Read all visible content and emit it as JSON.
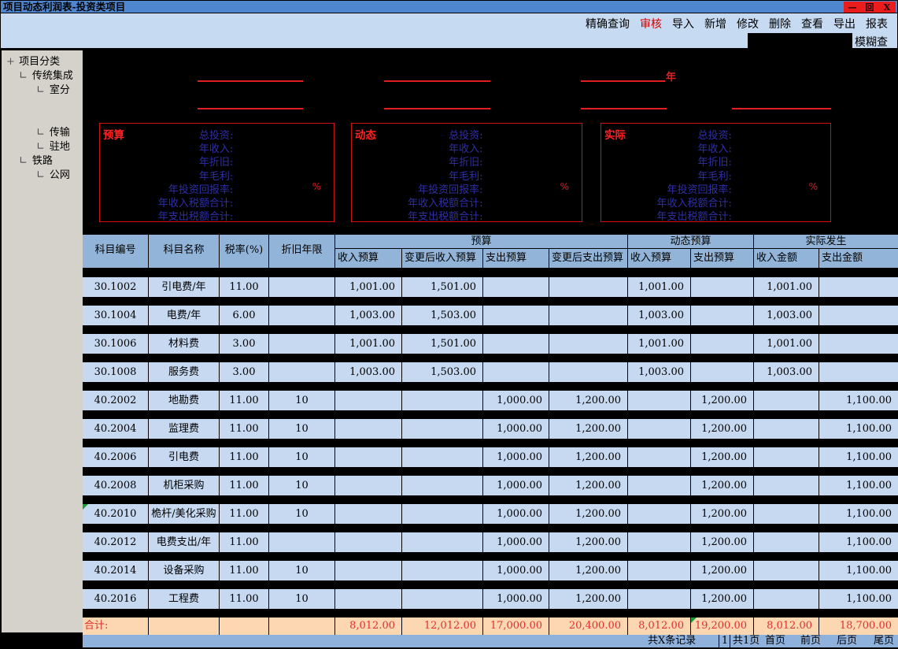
{
  "window": {
    "title": "项目动态利润表-投资类项目",
    "controls": {
      "minimize": "—",
      "restore": "回",
      "close": "X"
    }
  },
  "toolbar": {
    "buttons": [
      {
        "label": "精确查询"
      },
      {
        "label": "审核"
      },
      {
        "label": "导入"
      },
      {
        "label": "新增"
      },
      {
        "label": "修改"
      },
      {
        "label": "删除"
      },
      {
        "label": "查看"
      },
      {
        "label": "导出"
      },
      {
        "label": "报表"
      }
    ],
    "search": {
      "value": "",
      "fuzzy_label": "模糊查询"
    }
  },
  "tree": {
    "root": "项目分类",
    "items": [
      {
        "label": "传统集成",
        "level": 1
      },
      {
        "label": "室分",
        "level": 2
      },
      {
        "label": "传输",
        "level": 2
      },
      {
        "label": "驻地",
        "level": 2
      },
      {
        "label": "铁路",
        "level": 1
      },
      {
        "label": "公网",
        "level": 2
      }
    ]
  },
  "summary": {
    "year_char": "年",
    "percent": "%",
    "fields": [
      "总投资:",
      "年收入:",
      "年折旧:",
      "年毛利:",
      "年投资回报率:",
      "年收入税额合计:",
      "年支出税额合计:"
    ],
    "boxes": [
      {
        "title": "预算"
      },
      {
        "title": "动态"
      },
      {
        "title": "实际"
      }
    ]
  },
  "table": {
    "columns": [
      "科目编号",
      "科目名称",
      "税率(%)",
      "折旧年限"
    ],
    "groups": [
      "预算",
      "动态预算",
      "实际发生"
    ],
    "sub_columns": [
      "收入预算",
      "变更后收入预算",
      "支出预算",
      "变更后支出预算",
      "收入预算",
      "支出预算",
      "收入金额",
      "支出金额"
    ],
    "rows": [
      {
        "code": "30.1002",
        "name": "引电费/年",
        "tax": "11.00",
        "dep": "",
        "marker": false,
        "values": [
          "1,001.00",
          "1,501.00",
          "",
          "",
          "1,001.00",
          "",
          "1,001.00",
          ""
        ]
      },
      {
        "code": "30.1004",
        "name": "电费/年",
        "tax": "6.00",
        "dep": "",
        "marker": false,
        "values": [
          "1,003.00",
          "1,503.00",
          "",
          "",
          "1,003.00",
          "",
          "1,003.00",
          ""
        ]
      },
      {
        "code": "30.1006",
        "name": "材料费",
        "tax": "3.00",
        "dep": "",
        "marker": false,
        "values": [
          "1,001.00",
          "1,501.00",
          "",
          "",
          "1,001.00",
          "",
          "1,001.00",
          ""
        ]
      },
      {
        "code": "30.1008",
        "name": "服务费",
        "tax": "3.00",
        "dep": "",
        "marker": false,
        "values": [
          "1,003.00",
          "1,503.00",
          "",
          "",
          "1,003.00",
          "",
          "1,003.00",
          ""
        ]
      },
      {
        "code": "40.2002",
        "name": "地勘费",
        "tax": "11.00",
        "dep": "10",
        "marker": false,
        "values": [
          "",
          "",
          "1,000.00",
          "1,200.00",
          "",
          "1,200.00",
          "",
          "1,100.00"
        ]
      },
      {
        "code": "40.2004",
        "name": "监理费",
        "tax": "11.00",
        "dep": "10",
        "marker": false,
        "values": [
          "",
          "",
          "1,000.00",
          "1,200.00",
          "",
          "1,200.00",
          "",
          "1,100.00"
        ]
      },
      {
        "code": "40.2006",
        "name": "引电费",
        "tax": "11.00",
        "dep": "10",
        "marker": false,
        "values": [
          "",
          "",
          "1,000.00",
          "1,200.00",
          "",
          "1,200.00",
          "",
          "1,100.00"
        ]
      },
      {
        "code": "40.2008",
        "name": "机柜采购",
        "tax": "11.00",
        "dep": "10",
        "marker": false,
        "values": [
          "",
          "",
          "1,000.00",
          "1,200.00",
          "",
          "1,200.00",
          "",
          "1,100.00"
        ]
      },
      {
        "code": "40.2010",
        "name": "桅杆/美化采购",
        "tax": "11.00",
        "dep": "10",
        "marker": true,
        "values": [
          "",
          "",
          "1,000.00",
          "1,200.00",
          "",
          "1,200.00",
          "",
          "1,100.00"
        ]
      },
      {
        "code": "40.2012",
        "name": "电费支出/年",
        "tax": "11.00",
        "dep": "",
        "marker": false,
        "values": [
          "",
          "",
          "1,000.00",
          "1,200.00",
          "",
          "1,200.00",
          "",
          "1,100.00"
        ]
      },
      {
        "code": "40.2014",
        "name": "设备采购",
        "tax": "11.00",
        "dep": "10",
        "marker": false,
        "values": [
          "",
          "",
          "1,000.00",
          "1,200.00",
          "",
          "1,200.00",
          "",
          "1,100.00"
        ]
      },
      {
        "code": "40.2016",
        "name": "工程费",
        "tax": "11.00",
        "dep": "10",
        "marker": false,
        "values": [
          "",
          "",
          "1,000.00",
          "1,200.00",
          "",
          "1,200.00",
          "",
          "1,100.00"
        ]
      }
    ],
    "totals": {
      "label": "合计:",
      "values": [
        "8,012.00",
        "12,012.00",
        "17,000.00",
        "20,400.00",
        "8,012.00",
        "19,200.00",
        "8,012.00",
        "18,700.00"
      ],
      "marker_value_index": 5
    }
  },
  "footer": {
    "records": "共X条记录",
    "page_number": "1",
    "page_count": "共1页",
    "first": "首页",
    "prev": "前页",
    "next": "后页",
    "last": "尾页"
  },
  "colors": {
    "title_bar": "#4e87d0",
    "toolbar_bg": "#c6dbf2",
    "header_blue": "#92b4d8",
    "row_blue": "#c6d9f0",
    "totals_peach": "#fcd7b1",
    "footer_blue": "#8fb2dd",
    "accent_red": "#e02020",
    "summary_label_navy": "#2f2fa8",
    "tree_gray": "#d5d2cb",
    "marker_green": "#1f9a3a"
  }
}
